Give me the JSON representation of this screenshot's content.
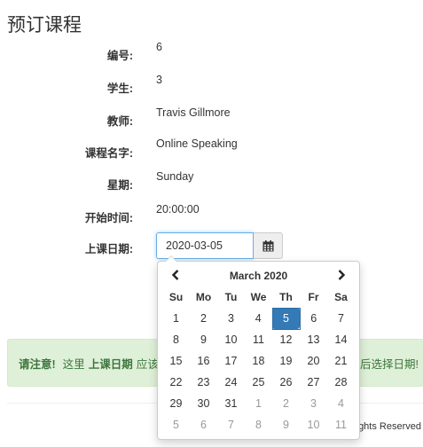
{
  "page": {
    "title": "预订课程"
  },
  "fields": [
    {
      "label": "编号:",
      "value": "6"
    },
    {
      "label": "学生:",
      "value": "3"
    },
    {
      "label": "教师:",
      "value": "Travis Gillmore"
    },
    {
      "label": "课程名字:",
      "value": "Online Speaking"
    },
    {
      "label": "星期:",
      "value": "Sunday"
    },
    {
      "label": "开始时间:",
      "value": "20:00:00"
    }
  ],
  "date_field": {
    "label": "上课日期:",
    "value": "2020-03-05",
    "button_icon": "calendar-icon"
  },
  "datepicker": {
    "prev_icon": "chevron-left-icon",
    "next_icon": "chevron-right-icon",
    "title": "March 2020",
    "weekdays": [
      "Su",
      "Mo",
      "Tu",
      "We",
      "Th",
      "Fr",
      "Sa"
    ],
    "weeks": [
      [
        {
          "d": "1"
        },
        {
          "d": "2"
        },
        {
          "d": "3"
        },
        {
          "d": "4"
        },
        {
          "d": "5",
          "state": "active"
        },
        {
          "d": "6"
        },
        {
          "d": "7"
        }
      ],
      [
        {
          "d": "8"
        },
        {
          "d": "9"
        },
        {
          "d": "10"
        },
        {
          "d": "11"
        },
        {
          "d": "12"
        },
        {
          "d": "13"
        },
        {
          "d": "14"
        }
      ],
      [
        {
          "d": "15"
        },
        {
          "d": "16"
        },
        {
          "d": "17"
        },
        {
          "d": "18"
        },
        {
          "d": "19"
        },
        {
          "d": "20"
        },
        {
          "d": "21"
        }
      ],
      [
        {
          "d": "22"
        },
        {
          "d": "23"
        },
        {
          "d": "24"
        },
        {
          "d": "25"
        },
        {
          "d": "26"
        },
        {
          "d": "27"
        },
        {
          "d": "28"
        }
      ],
      [
        {
          "d": "29"
        },
        {
          "d": "30"
        },
        {
          "d": "31"
        },
        {
          "d": "1",
          "state": "new"
        },
        {
          "d": "2",
          "state": "new"
        },
        {
          "d": "3",
          "state": "new"
        },
        {
          "d": "4",
          "state": "new"
        }
      ],
      [
        {
          "d": "5",
          "state": "new"
        },
        {
          "d": "6",
          "state": "new"
        },
        {
          "d": "7",
          "state": "new"
        },
        {
          "d": "8",
          "state": "new"
        },
        {
          "d": "9",
          "state": "new"
        },
        {
          "d": "10",
          "state": "new"
        },
        {
          "d": "11",
          "state": "new"
        }
      ]
    ]
  },
  "alert": {
    "strong": "请注意!",
    "text1": "这里",
    "highlight": "上课日期",
    "text2": "应该",
    "tail": "后选择日期!"
  },
  "footer": {
    "text": "ghts Reserved"
  },
  "colors": {
    "accent": "#337ab7",
    "alert_bg": "#dff0d8",
    "alert_text": "#3c763d"
  }
}
